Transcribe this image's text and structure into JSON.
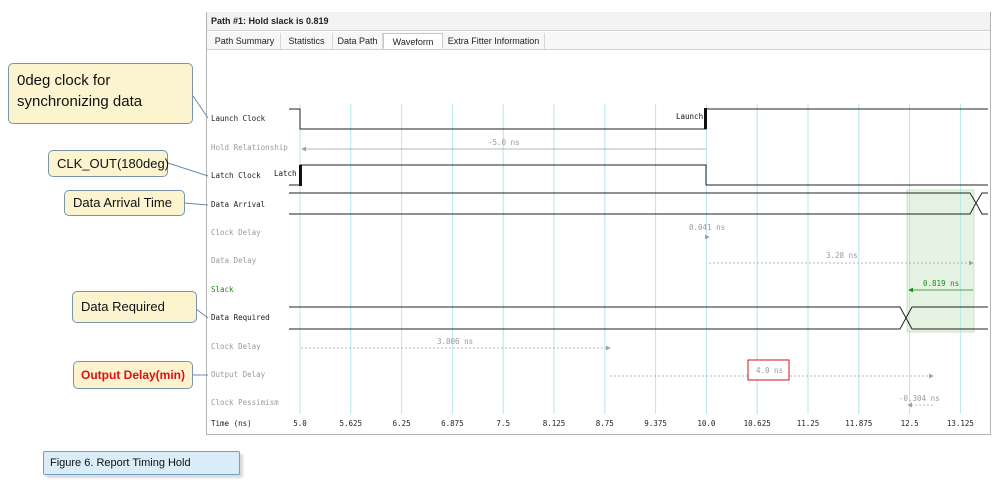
{
  "window": {
    "title": "Path #1: Hold slack is 0.819"
  },
  "tabs": [
    {
      "label": "Path Summary"
    },
    {
      "label": "Statistics"
    },
    {
      "label": "Data Path"
    },
    {
      "label": "Waveform",
      "active": true
    },
    {
      "label": "Extra Fitter Information"
    }
  ],
  "rows": {
    "launch_clock": "Launch Clock",
    "hold_relationship": "Hold Relationship",
    "latch_clock": "Latch Clock",
    "data_arrival": "Data Arrival",
    "clock_delay_1": "Clock Delay",
    "data_delay": "Data Delay",
    "slack": "Slack",
    "data_required": "Data Required",
    "clock_delay_2": "Clock Delay",
    "output_delay": "Output Delay",
    "clock_pessimism": "Clock Pessimism",
    "time_axis": "Time (ns)"
  },
  "waveform": {
    "launch_marker": "Launch",
    "latch_marker": "Latch",
    "hold_relationship_value": "-5.0 ns",
    "clock_delay_1_value": "0.041 ns",
    "data_delay_value": "3.28 ns",
    "slack_value": "0.819 ns",
    "clock_delay_2_value": "3.806 ns",
    "output_delay_value": "4.0 ns",
    "clock_pessimism_value": "-0.304 ns",
    "time_ticks": [
      "5.0",
      "5.625",
      "6.25",
      "6.875",
      "7.5",
      "8.125",
      "8.75",
      "9.375",
      "10.0",
      "10.625",
      "11.25",
      "11.875",
      "12.5",
      "13.125"
    ]
  },
  "callouts": {
    "launch_clock": "0deg clock for synchronizing data",
    "latch_clock": "CLK_OUT(180deg)",
    "data_arrival": "Data Arrival Time",
    "data_required": "Data Required",
    "output_delay": "Output Delay(min)"
  },
  "caption": "Figure 6. Report Timing Hold",
  "colors": {
    "gridline": "#b4e8ee",
    "slack_green": "#1c8a1c",
    "slack_region": "#e6f2e2",
    "highlight_box": "#d01515",
    "callout_fill": "#fcf3cf",
    "callout_border": "#7a93ad",
    "output_delay_text": "#e01010",
    "caption_fill": "#d9ecf8"
  }
}
